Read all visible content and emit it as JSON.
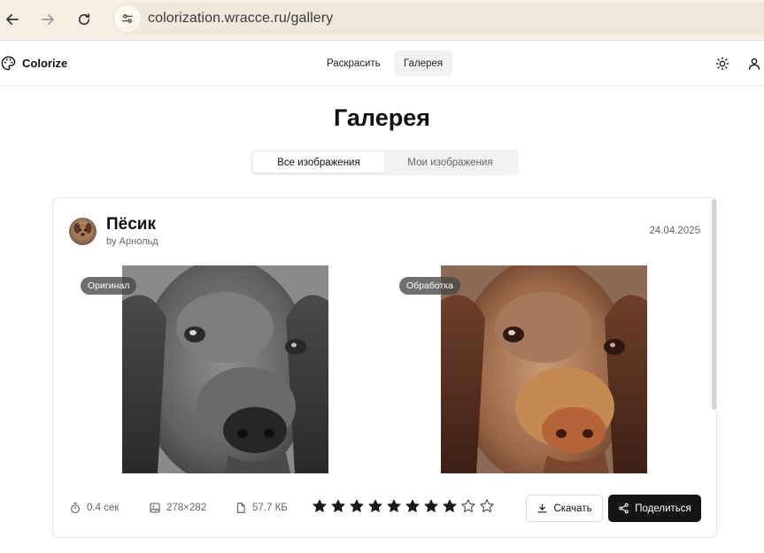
{
  "browser": {
    "url": "colorization.wracce.ru/gallery"
  },
  "header": {
    "brand": "Colorize",
    "nav": [
      {
        "label": "Раскрасить",
        "active": false
      },
      {
        "label": "Галерея",
        "active": true
      }
    ]
  },
  "page": {
    "title": "Галерея",
    "tabs": [
      {
        "label": "Все изображения",
        "active": true
      },
      {
        "label": "Мои изображения",
        "active": false
      }
    ]
  },
  "card": {
    "title": "Пёсик",
    "author": "by Арнольд",
    "date": "24.04.2025",
    "original_badge": "Оригинал",
    "processed_badge": "Обработка",
    "time": "0.4 сек",
    "dimensions": "278×282",
    "size": "57.7 КБ",
    "rating": 8,
    "rating_max": 10,
    "download_label": "Скачать",
    "share_label": "Поделиться"
  },
  "colors": {
    "accent": "#141414",
    "browser_bar": "#f8efe4",
    "star": "#1a1a1a"
  }
}
